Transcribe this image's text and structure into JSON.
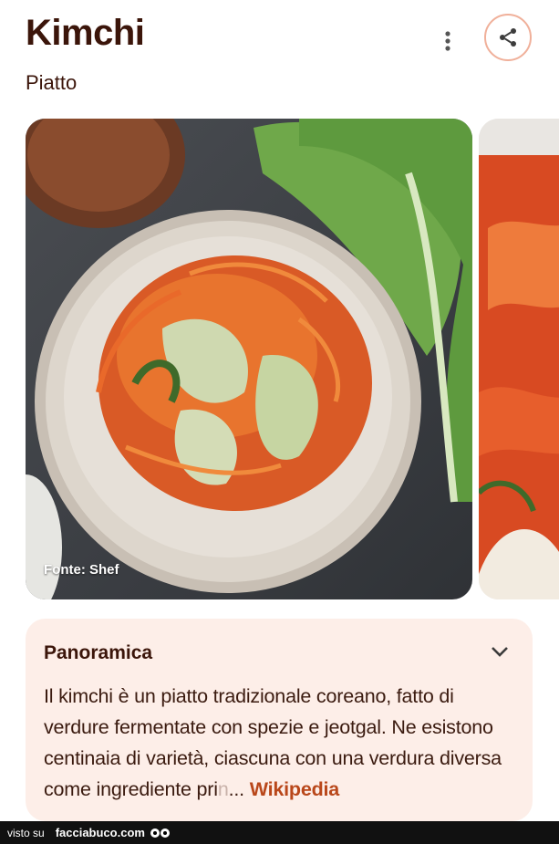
{
  "header": {
    "title": "Kimchi",
    "subtitle": "Piatto",
    "more_icon": "more-vertical-icon",
    "share_icon": "share-icon",
    "accent_color": "#f0b09a"
  },
  "carousel": {
    "main_image_caption": "Fonte: Shef"
  },
  "overview": {
    "heading": "Panoramica",
    "text": "Il kimchi è un piatto tradizionale coreano, fatto di verdure fermentate con spezie e jeotgal. Ne esistono centinaia di varietà, ciascuna con una verdura diversa come ingrediente pri",
    "fade_text": "n",
    "ellipsis": "...",
    "source_link": "Wikipedia",
    "expand_icon": "chevron-down-icon",
    "background_color": "#fdeee8",
    "link_color": "#b9471a"
  },
  "footer": {
    "visto_su": "visto su",
    "site": "facciabuco.com"
  }
}
